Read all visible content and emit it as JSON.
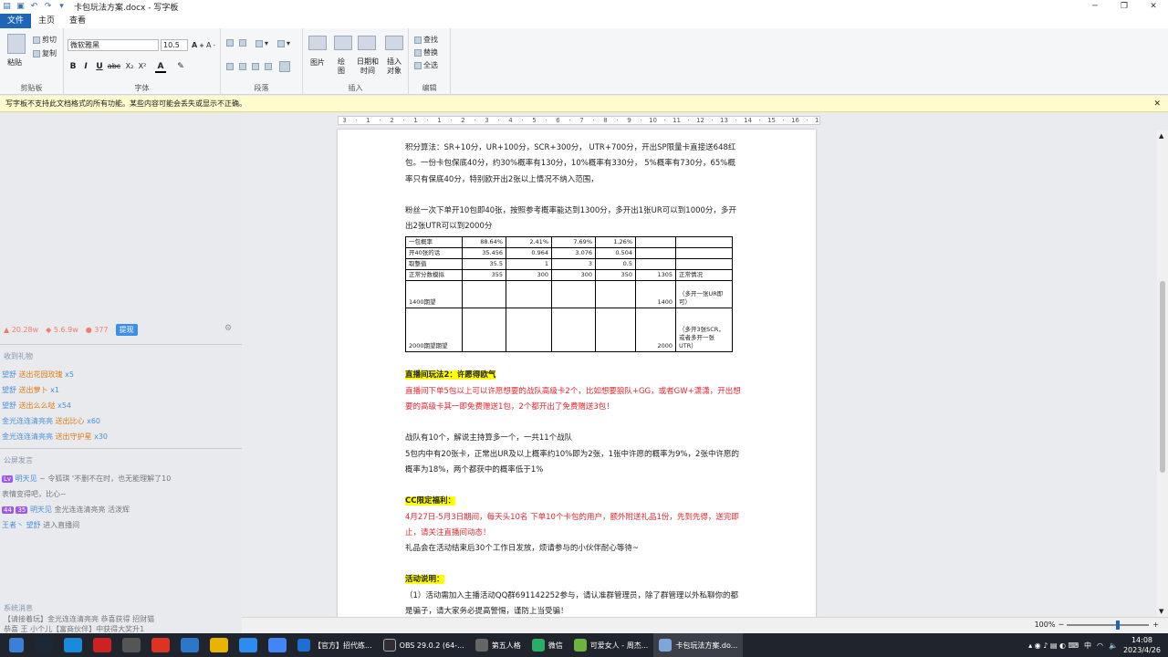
{
  "window": {
    "title": "卡包玩法方案.docx - 写字板",
    "min": "─",
    "max": "❐",
    "close": "✕"
  },
  "tabs": [
    "文件",
    "主页",
    "查看"
  ],
  "ribbon": {
    "clipboard": {
      "paste": "粘贴",
      "cut": "剪切",
      "copy": "复制",
      "label": "剪贴板"
    },
    "font": {
      "name": "微软雅黑",
      "size": "10.5",
      "label": "字体",
      "bold": "B",
      "italic": "I",
      "underline": "U",
      "strike": "abc",
      "sub": "X₂",
      "sup": "X²"
    },
    "paragraph": {
      "label": "段落"
    },
    "insert": {
      "picture": "图片",
      "paint": "绘图",
      "datetime": "日期和时间",
      "object": "插入对象",
      "label": "插入"
    },
    "edit": {
      "find": "查找",
      "replace": "替换",
      "selectall": "全选",
      "label": "编辑"
    }
  },
  "infobar": {
    "text": "写字板不支持此文档格式的所有功能。某些内容可能会丢失或显示不正确。",
    "close": "✕"
  },
  "ruler": [
    "3",
    "·",
    "1",
    "·",
    "2",
    "·",
    "1",
    "·",
    "1",
    "·",
    "2",
    "·",
    "3",
    "·",
    "4",
    "·",
    "5",
    "·",
    "6",
    "·",
    "7",
    "·",
    "8",
    "·",
    "9",
    "·",
    "10",
    "·",
    "11",
    "·",
    "12",
    "·",
    "13",
    "·",
    "14",
    "·",
    "15",
    "·",
    "16",
    "·",
    "17",
    "·"
  ],
  "stats": {
    "s1": "20.28w",
    "s2": "5.6.9w",
    "s3": "377",
    "btn": "提现"
  },
  "gifts": {
    "head": "收到礼物",
    "items": [
      {
        "user": "望舒",
        "gift": "送出花园玫瑰",
        "count": "x5"
      },
      {
        "user": "望舒",
        "gift": "送出萝卜",
        "count": "x1"
      },
      {
        "user": "望舒",
        "gift": "送出么么哒",
        "count": "x54"
      },
      {
        "user": "金光连连清亮亮",
        "gift": "送出比心",
        "count": "x60"
      },
      {
        "user": "金光连连清亮亮",
        "gift": "送出守护星",
        "count": "x30"
      }
    ]
  },
  "chat": {
    "head": "公屏发言",
    "lines": [
      {
        "name": "明天见",
        "text": "~ 令狐琪   '不删不在时，也无能理解了10"
      },
      {
        "name": "",
        "text": "表情变得吧，比心~"
      },
      {
        "name": "明天见",
        "text": "金光连连清亮亮  活泼辉"
      },
      {
        "name": "王者丶 望舒",
        "text": "进入直播间"
      }
    ]
  },
  "bottomleft": {
    "head": "系统消息",
    "line1": "【请接着玩】金光连连清亮亮 恭喜获得 招财猫",
    "line2": "恭喜 王 小个儿【富商伙伴】中获得大奖升1"
  },
  "doc": {
    "p1": "积分算法：SR+10分，UR+100分，SCR+300分，       UTR+700分，开出SP限量卡直接送648红包。一份卡包保底40分，约30%概率有130分，10%概率有330分，    5%概率有730分，65%概率只有保底40分，特别欧开出2张以上情况不纳入范围，",
    "p2": "粉丝一次下单开10包即40张，按照参考概率能达到1300分，多开出1张UR可以到1000分，多开出2张UTR可以到2000分",
    "table": [
      [
        "一包概率",
        "88.64%",
        "2.41%",
        "7.69%",
        "1.26%",
        "",
        ""
      ],
      [
        "开40张的话",
        "35.456",
        "0.964",
        "3.076",
        "0.504",
        "",
        ""
      ],
      [
        "取整值",
        "35.5",
        "1",
        "3",
        "0.5",
        "",
        ""
      ],
      [
        "正常分数模拟",
        "355",
        "300",
        "300",
        "350",
        "1305",
        "正常情况"
      ],
      [
        "1400期望",
        "",
        "",
        "",
        "",
        "1400",
        "（多开一张UR即可）"
      ],
      [
        "2000期望期望",
        "",
        "",
        "",
        "",
        "2000",
        "（多开3张SCR，或者多开一张UTR）"
      ]
    ],
    "h2": "直播间玩法2：许愿得欧气",
    "p3": "直播间下单5包以上可以许愿想要的战队高级卡2个，比如想要狼队+GG，或者GW+潇潇，开出想要的高级卡其一即免费赠送1包，2个都开出了免费赠送3包！",
    "p4": "战队有10个，解说主持算多一个，一共11个战队",
    "p5": "5包内中有20张卡，正常出UR及以上概率约10%即为2张，1张中许愿的概率为9%，2张中许愿的概率为18%，两个都获中的概率低于1%",
    "h3": "CC限定福利：",
    "p6": "4月27日-5月3日期间，每天头10名       下单10个卡包的用户，额外附送礼品1份，先到先得，送完即止，请关注直播间动态！",
    "p7": "礼品会在活动结束后30个工作日发放，烦请参与的小伙伴耐心等待~",
    "h4": "活动说明：",
    "p8": "（1）活动需加入主播活动QQ群691142252参与，请认准群管理员，除了群管理以外私聊你的都是骗子，请大家务必提高警惕，谨防上当受骗！"
  },
  "status": {
    "zoom": "100%",
    "minus": "─",
    "plus": "+"
  },
  "taskbar": {
    "apps": [
      "【官方】招代练...",
      "OBS 29.0.2 (64-...",
      "第五人格",
      "微信",
      "可爱女人 - 周杰...",
      "卡包玩法方案.do..."
    ],
    "tray": "中",
    "time": "14:08",
    "date": "2023/4/26"
  },
  "colors": {
    "accent": "#1e65b8",
    "highlight": "#ffff00",
    "red": "#e8242c"
  }
}
